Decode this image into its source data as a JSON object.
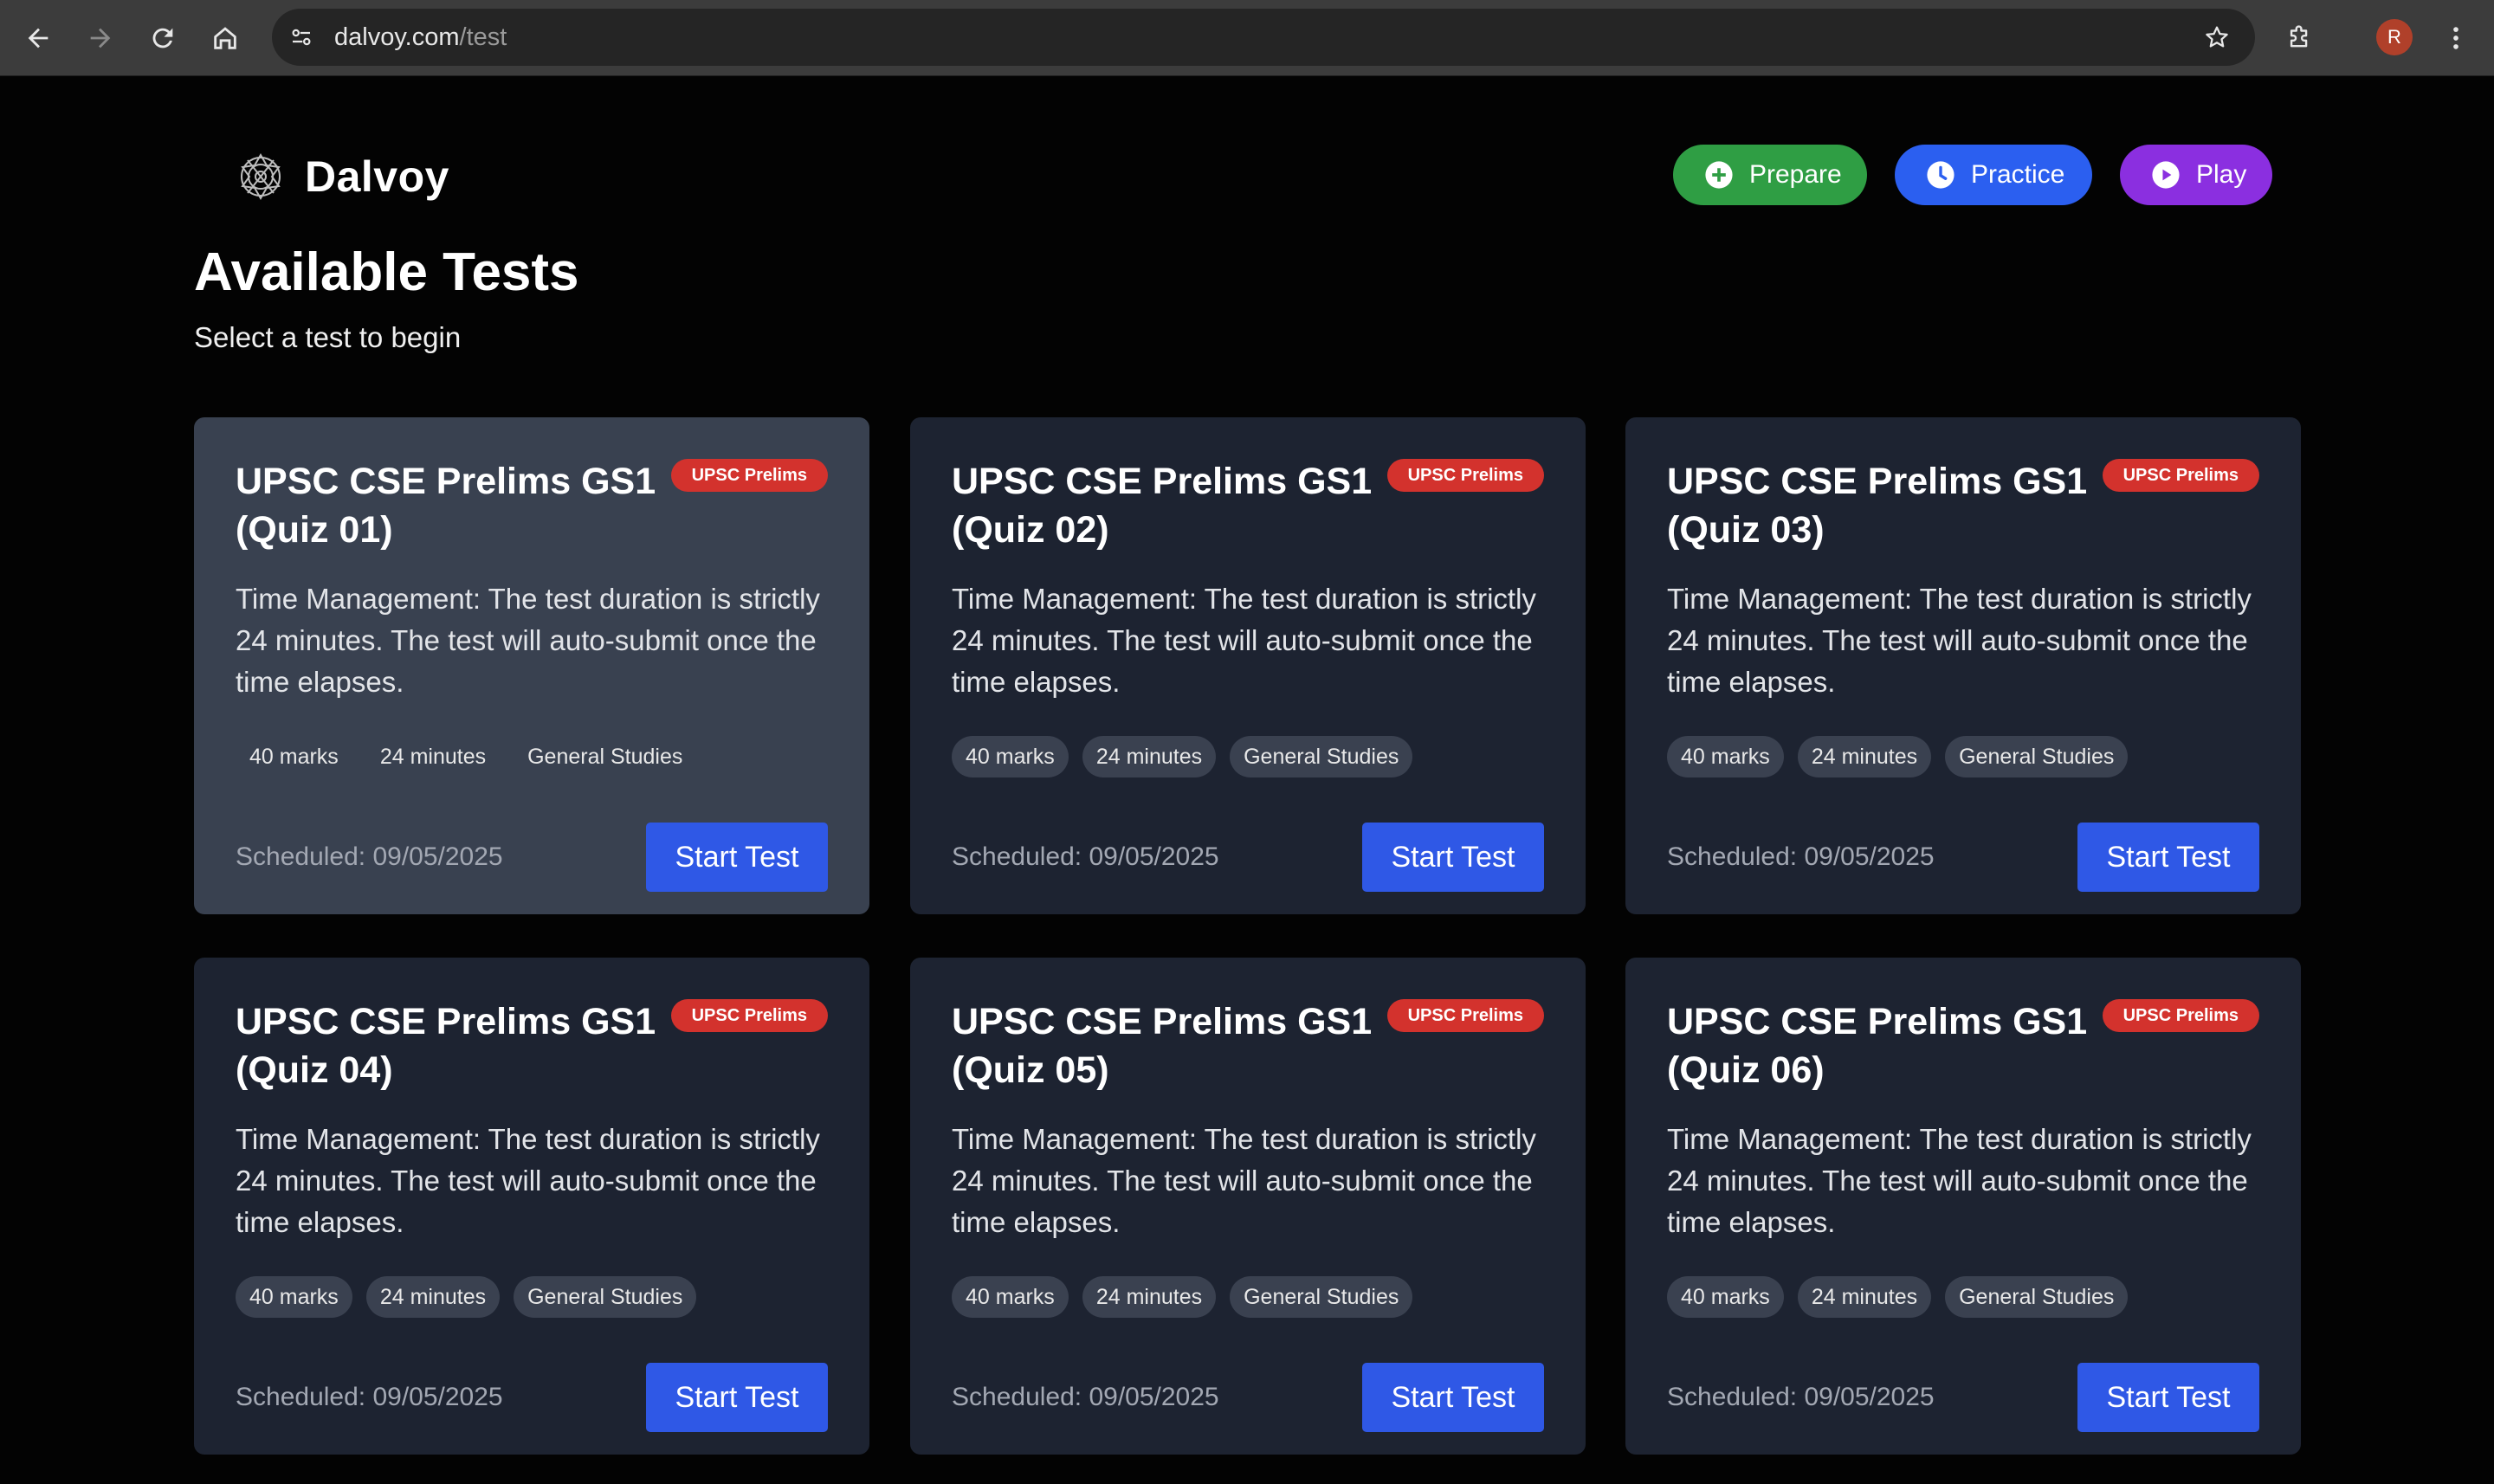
{
  "browser": {
    "url_host": "dalvoy.com",
    "url_path": "/test",
    "profile_initial": "R"
  },
  "brand": {
    "name": "Dalvoy"
  },
  "nav": {
    "prepare": "Prepare",
    "practice": "Practice",
    "play": "Play"
  },
  "header": {
    "title": "Available Tests",
    "subtitle": "Select a test to begin"
  },
  "colors": {
    "prepare": "#2f9e44",
    "practice": "#2b5ff0",
    "play": "#8b2fe0",
    "badge": "#d3322d",
    "start_button": "#2f58e6"
  },
  "cards": [
    {
      "title": "UPSC CSE Prelims GS1 (Quiz 01)",
      "badge": "UPSC Prelims",
      "description": "Time Management: The test duration is strictly 24 minutes. The test will auto-submit once the time elapses.",
      "tags": [
        "40 marks",
        "24 minutes",
        "General Studies"
      ],
      "scheduled": "Scheduled: 09/05/2025",
      "button": "Start Test"
    },
    {
      "title": "UPSC CSE Prelims GS1 (Quiz 02)",
      "badge": "UPSC Prelims",
      "description": "Time Management: The test duration is strictly 24 minutes. The test will auto-submit once the time elapses.",
      "tags": [
        "40 marks",
        "24 minutes",
        "General Studies"
      ],
      "scheduled": "Scheduled: 09/05/2025",
      "button": "Start Test"
    },
    {
      "title": "UPSC CSE Prelims GS1 (Quiz 03)",
      "badge": "UPSC Prelims",
      "description": "Time Management: The test duration is strictly 24 minutes. The test will auto-submit once the time elapses.",
      "tags": [
        "40 marks",
        "24 minutes",
        "General Studies"
      ],
      "scheduled": "Scheduled: 09/05/2025",
      "button": "Start Test"
    },
    {
      "title": "UPSC CSE Prelims GS1 (Quiz 04)",
      "badge": "UPSC Prelims",
      "description": "Time Management: The test duration is strictly 24 minutes. The test will auto-submit once the time elapses.",
      "tags": [
        "40 marks",
        "24 minutes",
        "General Studies"
      ],
      "scheduled": "Scheduled: 09/05/2025",
      "button": "Start Test"
    },
    {
      "title": "UPSC CSE Prelims GS1 (Quiz 05)",
      "badge": "UPSC Prelims",
      "description": "Time Management: The test duration is strictly 24 minutes. The test will auto-submit once the time elapses.",
      "tags": [
        "40 marks",
        "24 minutes",
        "General Studies"
      ],
      "scheduled": "Scheduled: 09/05/2025",
      "button": "Start Test"
    },
    {
      "title": "UPSC CSE Prelims GS1 (Quiz 06)",
      "badge": "UPSC Prelims",
      "description": "Time Management: The test duration is strictly 24 minutes. The test will auto-submit once the time elapses.",
      "tags": [
        "40 marks",
        "24 minutes",
        "General Studies"
      ],
      "scheduled": "Scheduled: 09/05/2025",
      "button": "Start Test"
    }
  ]
}
